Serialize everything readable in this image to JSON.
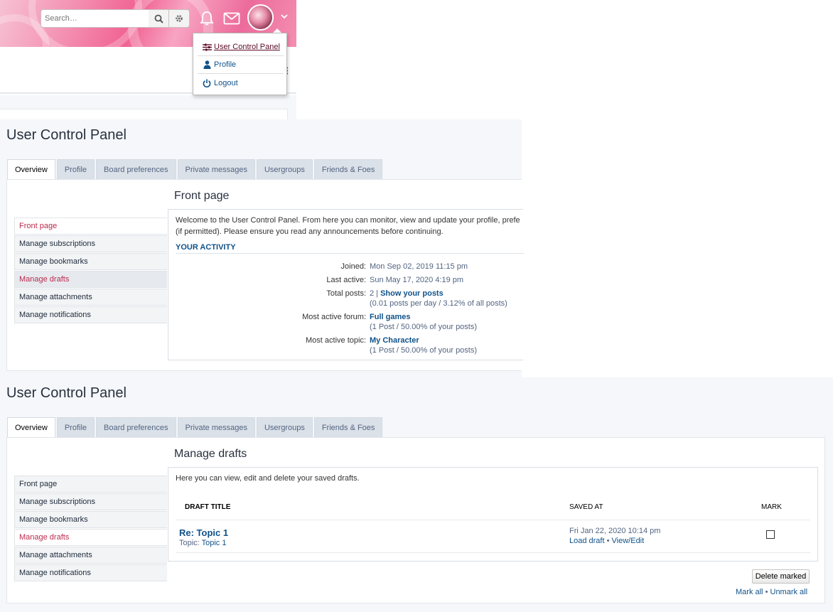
{
  "header": {
    "search_placeholder": "Search…",
    "icons": [
      "search-icon",
      "gear-icon",
      "bell-icon",
      "envelope-icon",
      "chevron-down-icon"
    ],
    "accent_color": "#f06292"
  },
  "dropdown": {
    "items": [
      {
        "label": "User Control Panel",
        "icon": "sliders-icon"
      },
      {
        "label": "Profile",
        "icon": "user-icon"
      },
      {
        "label": "Logout",
        "icon": "power-icon"
      }
    ]
  },
  "ucp1": {
    "title": "User Control Panel",
    "tabs": [
      "Overview",
      "Profile",
      "Board preferences",
      "Private messages",
      "Usergroups",
      "Friends & Foes"
    ],
    "menu": [
      "Front page",
      "Manage subscriptions",
      "Manage bookmarks",
      "Manage drafts",
      "Manage attachments",
      "Manage notifications"
    ],
    "section_title": "Front page",
    "intro_line1": "Welcome to the User Control Panel. From here you can monitor, view and update your profile, prefe",
    "intro_line2": "(if permitted). Please ensure you read any announcements before continuing.",
    "activity_heading": "YOUR ACTIVITY",
    "activity": {
      "joined_label": "Joined:",
      "joined_value": "Mon Sep 02, 2019 11:15 pm",
      "last_active_label": "Last active:",
      "last_active_value": "Sun May 17, 2020 4:19 pm",
      "total_posts_label": "Total posts:",
      "total_posts_value": "2 |",
      "total_posts_link": "Show your posts",
      "total_posts_sub": "(0.01 posts per day / 3.12% of all posts)",
      "forum_label": "Most active forum:",
      "forum_link": "Full games",
      "forum_sub": "(1 Post / 50.00% of your posts)",
      "topic_label": "Most active topic:",
      "topic_link": "My Character",
      "topic_sub": "(1 Post / 50.00% of your posts)"
    }
  },
  "ucp2": {
    "title": "User Control Panel",
    "tabs": [
      "Overview",
      "Profile",
      "Board preferences",
      "Private messages",
      "Usergroups",
      "Friends & Foes"
    ],
    "menu": [
      "Front page",
      "Manage subscriptions",
      "Manage bookmarks",
      "Manage drafts",
      "Manage attachments",
      "Manage notifications"
    ],
    "section_title": "Manage drafts",
    "intro": "Here you can view, edit and delete your saved drafts.",
    "columns": [
      "DRAFT TITLE",
      "SAVED AT",
      "MARK"
    ],
    "draft": {
      "title": "Re: Topic 1",
      "topic_label": "Topic:",
      "topic_link": "Topic 1",
      "saved_at": "Fri Jan 22, 2020 10:14 pm",
      "load_draft": "Load draft",
      "bullet": "•",
      "view_edit": "View/Edit"
    },
    "delete_button": "Delete marked",
    "mark_all": "Mark all",
    "unmark_all": "Unmark all"
  }
}
